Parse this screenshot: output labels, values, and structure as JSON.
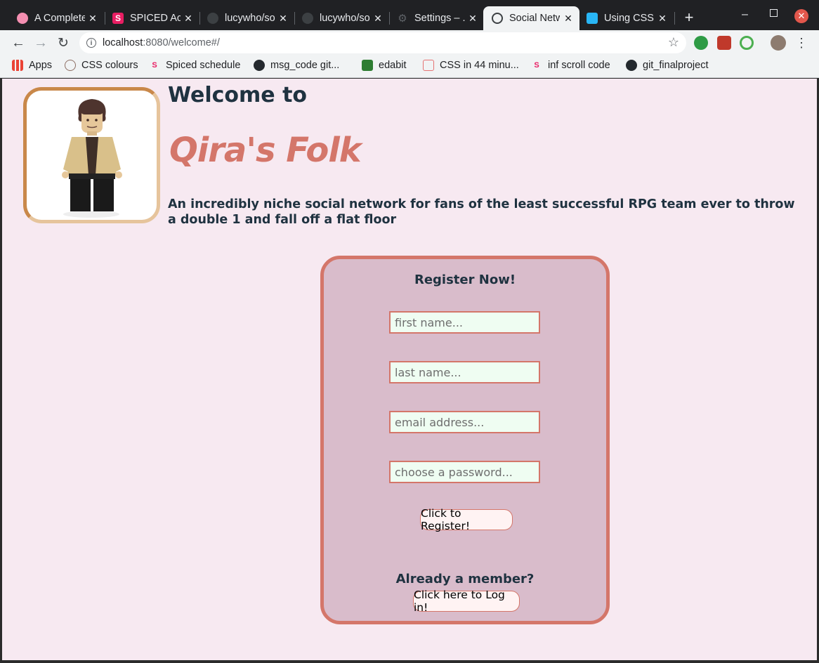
{
  "browser": {
    "tabs": [
      {
        "title": "A Complete Guide",
        "icon": "pink-circle-icon",
        "color": "#f48fb1"
      },
      {
        "title": "SPICED Academy",
        "icon": "spiced-icon",
        "color": "#e91e63"
      },
      {
        "title": "lucywho/social",
        "icon": "github-icon",
        "color": "#5f6368"
      },
      {
        "title": "lucywho/social",
        "icon": "github-icon",
        "color": "#5f6368"
      },
      {
        "title": "Settings – ...",
        "icon": "gear-icon",
        "color": "#5f6368"
      },
      {
        "title": "Social Network",
        "icon": "globe-icon",
        "color": "#202124",
        "active": true
      },
      {
        "title": "Using CSS",
        "icon": "css-icon",
        "color": "#29b6f6"
      }
    ],
    "url_host": "localhost",
    "url_path": ":8080/welcome#/",
    "bookmarks": [
      {
        "label": "Apps",
        "icon": "apps-grid-icon"
      },
      {
        "label": "CSS colours",
        "icon": "palette-icon"
      },
      {
        "label": "Spiced schedule",
        "icon": "spiced-icon"
      },
      {
        "label": "msg_code git...",
        "icon": "github-icon"
      },
      {
        "label": "edabit",
        "icon": "edabit-icon"
      },
      {
        "label": "CSS in 44 minu...",
        "icon": "doc-icon"
      },
      {
        "label": "inf scroll code",
        "icon": "spiced-icon"
      },
      {
        "label": "git_finalproject",
        "icon": "github-icon"
      }
    ]
  },
  "page": {
    "welcome": "Welcome to",
    "site_title": "Qira's Folk",
    "tagline": "An incredibly niche social network for fans of the least successful RPG team ever to throw a double 1 and fall off a flat floor",
    "register": {
      "title": "Register Now!",
      "first_name_placeholder": "first name...",
      "last_name_placeholder": "last name...",
      "email_placeholder": "email address...",
      "password_placeholder": "choose a password...",
      "register_button": "Click to Register!",
      "member_question": "Already a member?",
      "login_button": "Click here to Log in!"
    }
  },
  "colors": {
    "page_bg": "#f7e9f1",
    "accent": "#d4766a",
    "card_bg": "#d9bccb",
    "input_bg": "#effdf2",
    "text_dark": "#1f3240"
  }
}
